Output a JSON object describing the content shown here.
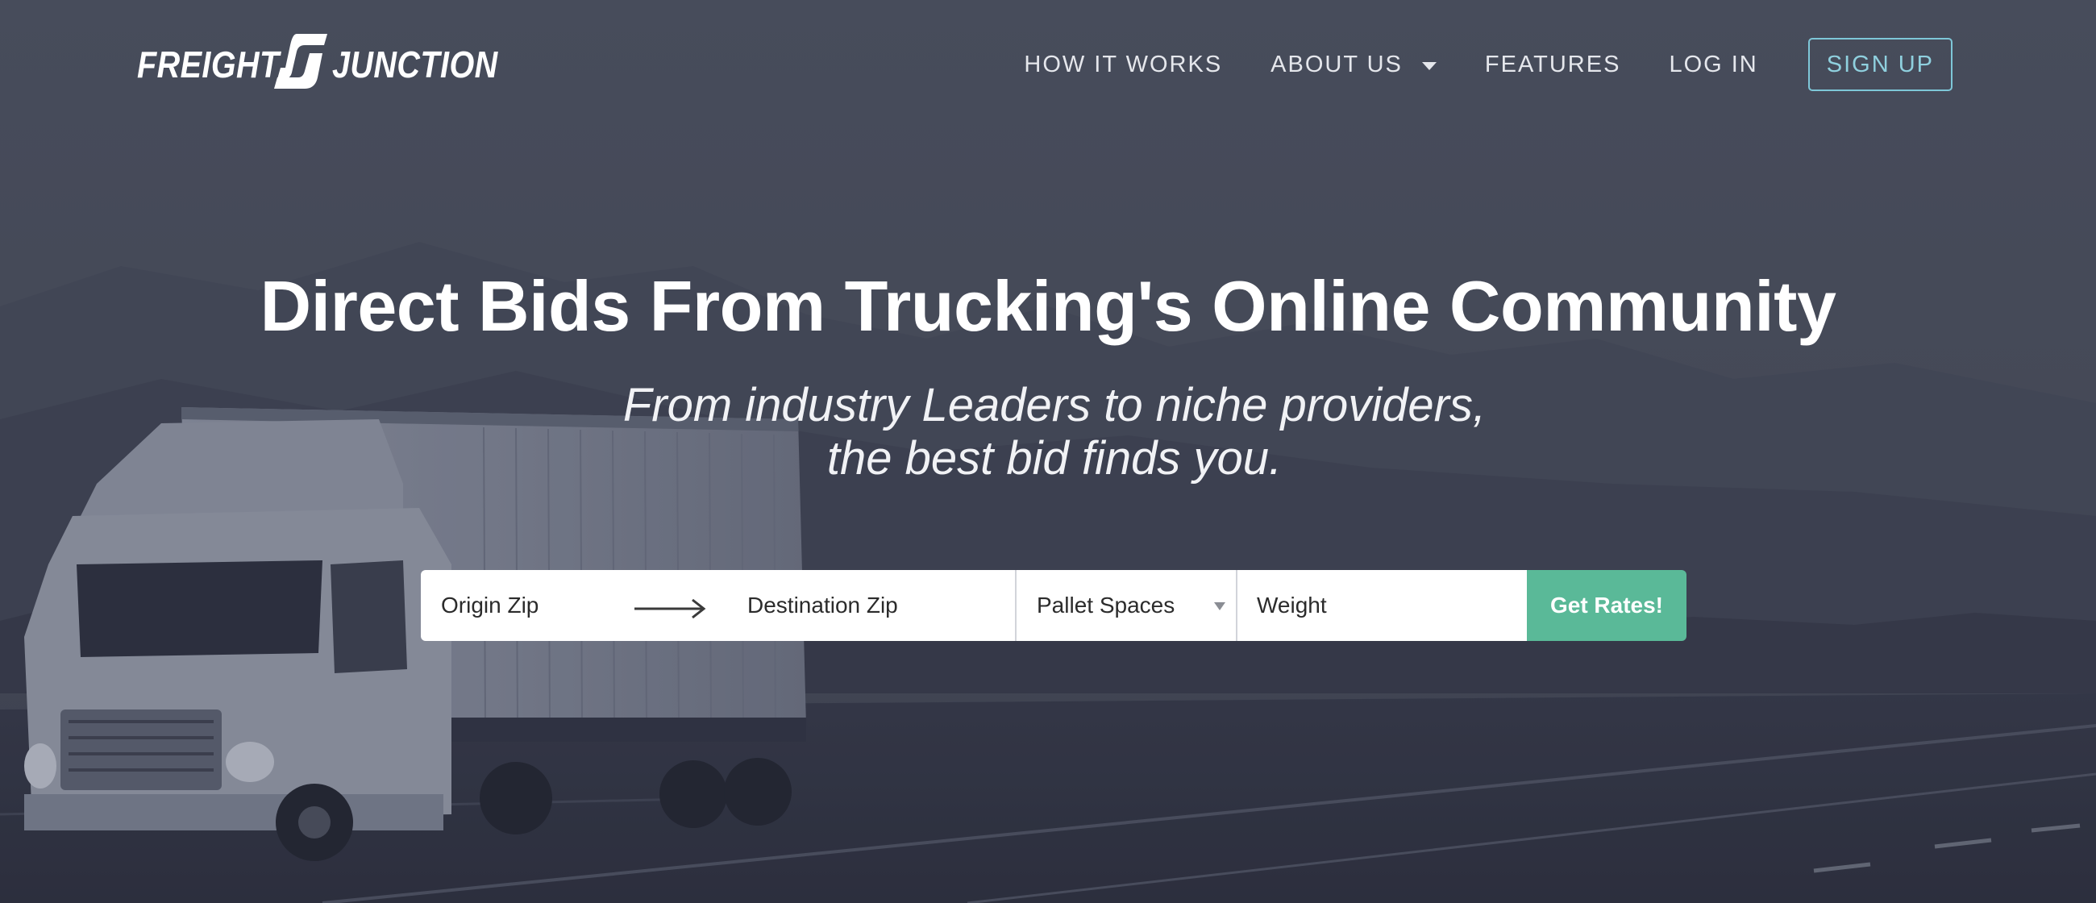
{
  "brand": {
    "name_first": "FREIGHT",
    "name_second": "JUNCTION",
    "accent_color": "#5ab998",
    "signup_outline_color": "#7ec7d8"
  },
  "nav": {
    "items": [
      {
        "label": "HOW IT WORKS"
      },
      {
        "label": "ABOUT US",
        "has_dropdown": true
      },
      {
        "label": "FEATURES"
      },
      {
        "label": "LOG IN"
      }
    ],
    "signup_label": "SIGN UP"
  },
  "hero": {
    "headline": "Direct Bids From Trucking's Online Community",
    "tagline_line1": "From industry Leaders to niche providers,",
    "tagline_line2": "the best bid finds you."
  },
  "search": {
    "origin_placeholder": "Origin Zip",
    "destination_placeholder": "Destination Zip",
    "pallet_placeholder": "Pallet Spaces",
    "weight_placeholder": "Weight",
    "submit_label": "Get Rates!"
  },
  "icons": {
    "logo_mark": "brand-logo-icon",
    "route_arrow": "arrow-right-icon",
    "dropdown": "caret-down-icon",
    "select": "select-arrow-icon"
  }
}
